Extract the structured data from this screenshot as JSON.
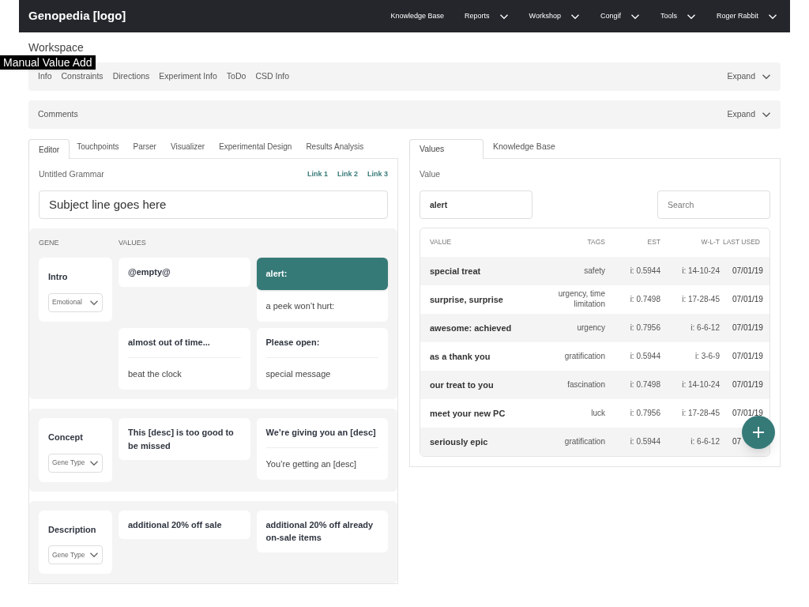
{
  "navbar": {
    "brand": "Genopedia [logo]",
    "items": [
      {
        "label": "Knowledge Base",
        "dropdown": false
      },
      {
        "label": "Reports",
        "dropdown": true
      },
      {
        "label": "Workshop",
        "dropdown": true
      },
      {
        "label": "Congif",
        "dropdown": true
      },
      {
        "label": "Tools",
        "dropdown": true
      },
      {
        "label": "Roger Rabbit",
        "dropdown": true
      }
    ]
  },
  "page_title": "Workspace",
  "tooltip": "Manual Value Add",
  "info_bar": {
    "tabs": [
      "Info",
      "Constraints",
      "Directions",
      "Experiment Info",
      "ToDo",
      "CSD Info"
    ],
    "expand": "Expand"
  },
  "comments_bar": {
    "label": "Comments",
    "expand": "Expand"
  },
  "left_tabs": [
    {
      "label": "Editor",
      "selected": true
    },
    {
      "label": "Touchpoints",
      "selected": false
    },
    {
      "label": "Parser",
      "selected": false
    },
    {
      "label": "Visualizer",
      "selected": false
    },
    {
      "label": "Experimental Design",
      "selected": false
    },
    {
      "label": "Results Analysis",
      "selected": false
    }
  ],
  "editor": {
    "grammar_name": "Untitled Grammar",
    "links": [
      "Link 1",
      "Link 2",
      "Link 3"
    ],
    "subject": "Subject line goes here",
    "headers": [
      "GENE",
      "VALUES"
    ],
    "genes": [
      {
        "name": "Intro",
        "type": {
          "value": "Emotional"
        },
        "values": [
          {
            "title": "@empty@",
            "selected": false
          },
          {
            "title": "alert:",
            "alt": "a peek won’t hurt:",
            "selected": true
          },
          {
            "title": "almost out of time...",
            "alt": "beat the clock",
            "selected": false
          },
          {
            "title": "Please open:",
            "alt": "special message",
            "selected": false
          }
        ]
      },
      {
        "name": "Concept",
        "type": {
          "placeholder": "Gene Type"
        },
        "values": [
          {
            "title": "This [desc] is too good to be missed",
            "selected": false
          },
          {
            "title": "We’re giving you an [desc]",
            "alt": "You’re getting an [desc]",
            "selected": false
          }
        ]
      },
      {
        "name": "Description",
        "type": {
          "placeholder": "Gene Type"
        },
        "values": [
          {
            "title": "additional 20% off sale",
            "selected": false
          },
          {
            "title": "additional 20% off already on-sale items",
            "selected": false
          }
        ]
      }
    ]
  },
  "right_tabs": [
    {
      "label": "Values",
      "selected": true
    },
    {
      "label": "Knowledge Base",
      "selected": false
    }
  ],
  "values_panel": {
    "value_label": "Value",
    "value_input": "alert",
    "search_placeholder": "Search",
    "columns": [
      "VALUE",
      "TAGS",
      "EST",
      "W-L-T",
      "LAST USED"
    ],
    "rows": [
      [
        "special treat",
        "safety",
        "i: 0.5944",
        "i: 14-10-24",
        "07/01/19"
      ],
      [
        "surprise, surprise",
        "urgency, time limitation",
        "i: 0.7498",
        "i: 17-28-45",
        "07/01/19"
      ],
      [
        "awesome: achieved",
        "urgency",
        "i: 0.7956",
        "i: 6-6-12",
        "07/01/19"
      ],
      [
        "as a thank you",
        "gratification",
        "i: 0.5944",
        "i: 3-6-9",
        "07/01/19"
      ],
      [
        "our treat to you",
        "fascination",
        "i: 0.7498",
        "i: 14-10-24",
        "07/01/19"
      ],
      [
        "meet your new PC",
        "luck",
        "i: 0.7956",
        "i: 17-28-45",
        "07/01/19"
      ],
      [
        "seriously epic",
        "gratification",
        "i: 0.5944",
        "i: 6-6-12",
        "07"
      ]
    ]
  }
}
